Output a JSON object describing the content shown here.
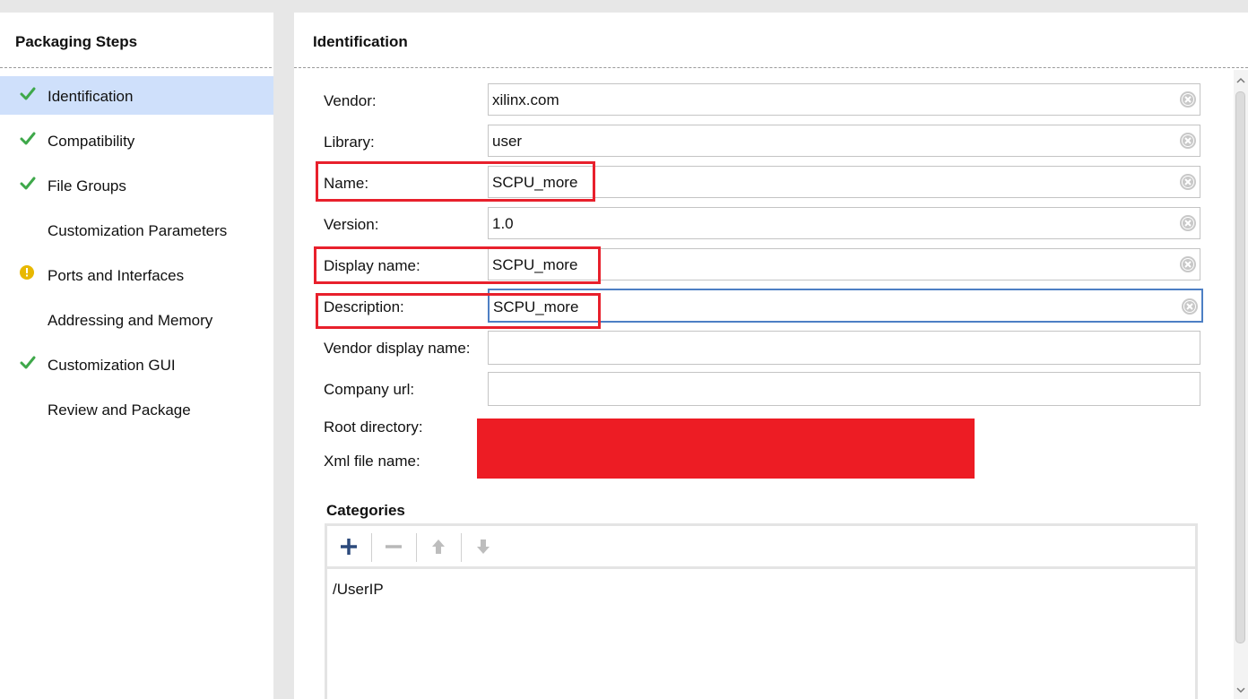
{
  "left_panel": {
    "title": "Packaging Steps",
    "steps": [
      {
        "label": "Identification",
        "status": "check",
        "active": true
      },
      {
        "label": "Compatibility",
        "status": "check"
      },
      {
        "label": "File Groups",
        "status": "check"
      },
      {
        "label": "Customization Parameters",
        "status": "none"
      },
      {
        "label": "Ports and Interfaces",
        "status": "warning"
      },
      {
        "label": "Addressing and Memory",
        "status": "none"
      },
      {
        "label": "Customization GUI",
        "status": "check"
      },
      {
        "label": "Review and Package",
        "status": "none"
      }
    ]
  },
  "main": {
    "title": "Identification",
    "fields": [
      {
        "label": "Vendor:",
        "value": "xilinx.com"
      },
      {
        "label": "Library:",
        "value": "user"
      },
      {
        "label": "Name:",
        "value": "SCPU_more"
      },
      {
        "label": "Version:",
        "value": "1.0"
      },
      {
        "label": "Display name:",
        "value": "SCPU_more"
      },
      {
        "label": "Description:",
        "value": "SCPU_more"
      },
      {
        "label": "Vendor display name:",
        "value": ""
      },
      {
        "label": "Company url:",
        "value": ""
      }
    ],
    "root_directory_label": "Root directory:",
    "xml_file_name_label": "Xml file name:",
    "categories": {
      "title": "Categories",
      "items": [
        "/UserIP"
      ]
    }
  },
  "colors": {
    "check": "#3ea84a",
    "warning": "#e8b800",
    "highlight_box": "#e8202c",
    "redaction": "#ed1c24",
    "active_row": "#cfe0fb",
    "focus_border": "#4d7fc4"
  },
  "icons": {
    "check": "check-icon",
    "warning": "warning-icon",
    "clear": "clear-circle-icon",
    "add": "plus-icon",
    "remove": "minus-icon",
    "up": "arrow-up-icon",
    "down": "arrow-down-icon"
  }
}
